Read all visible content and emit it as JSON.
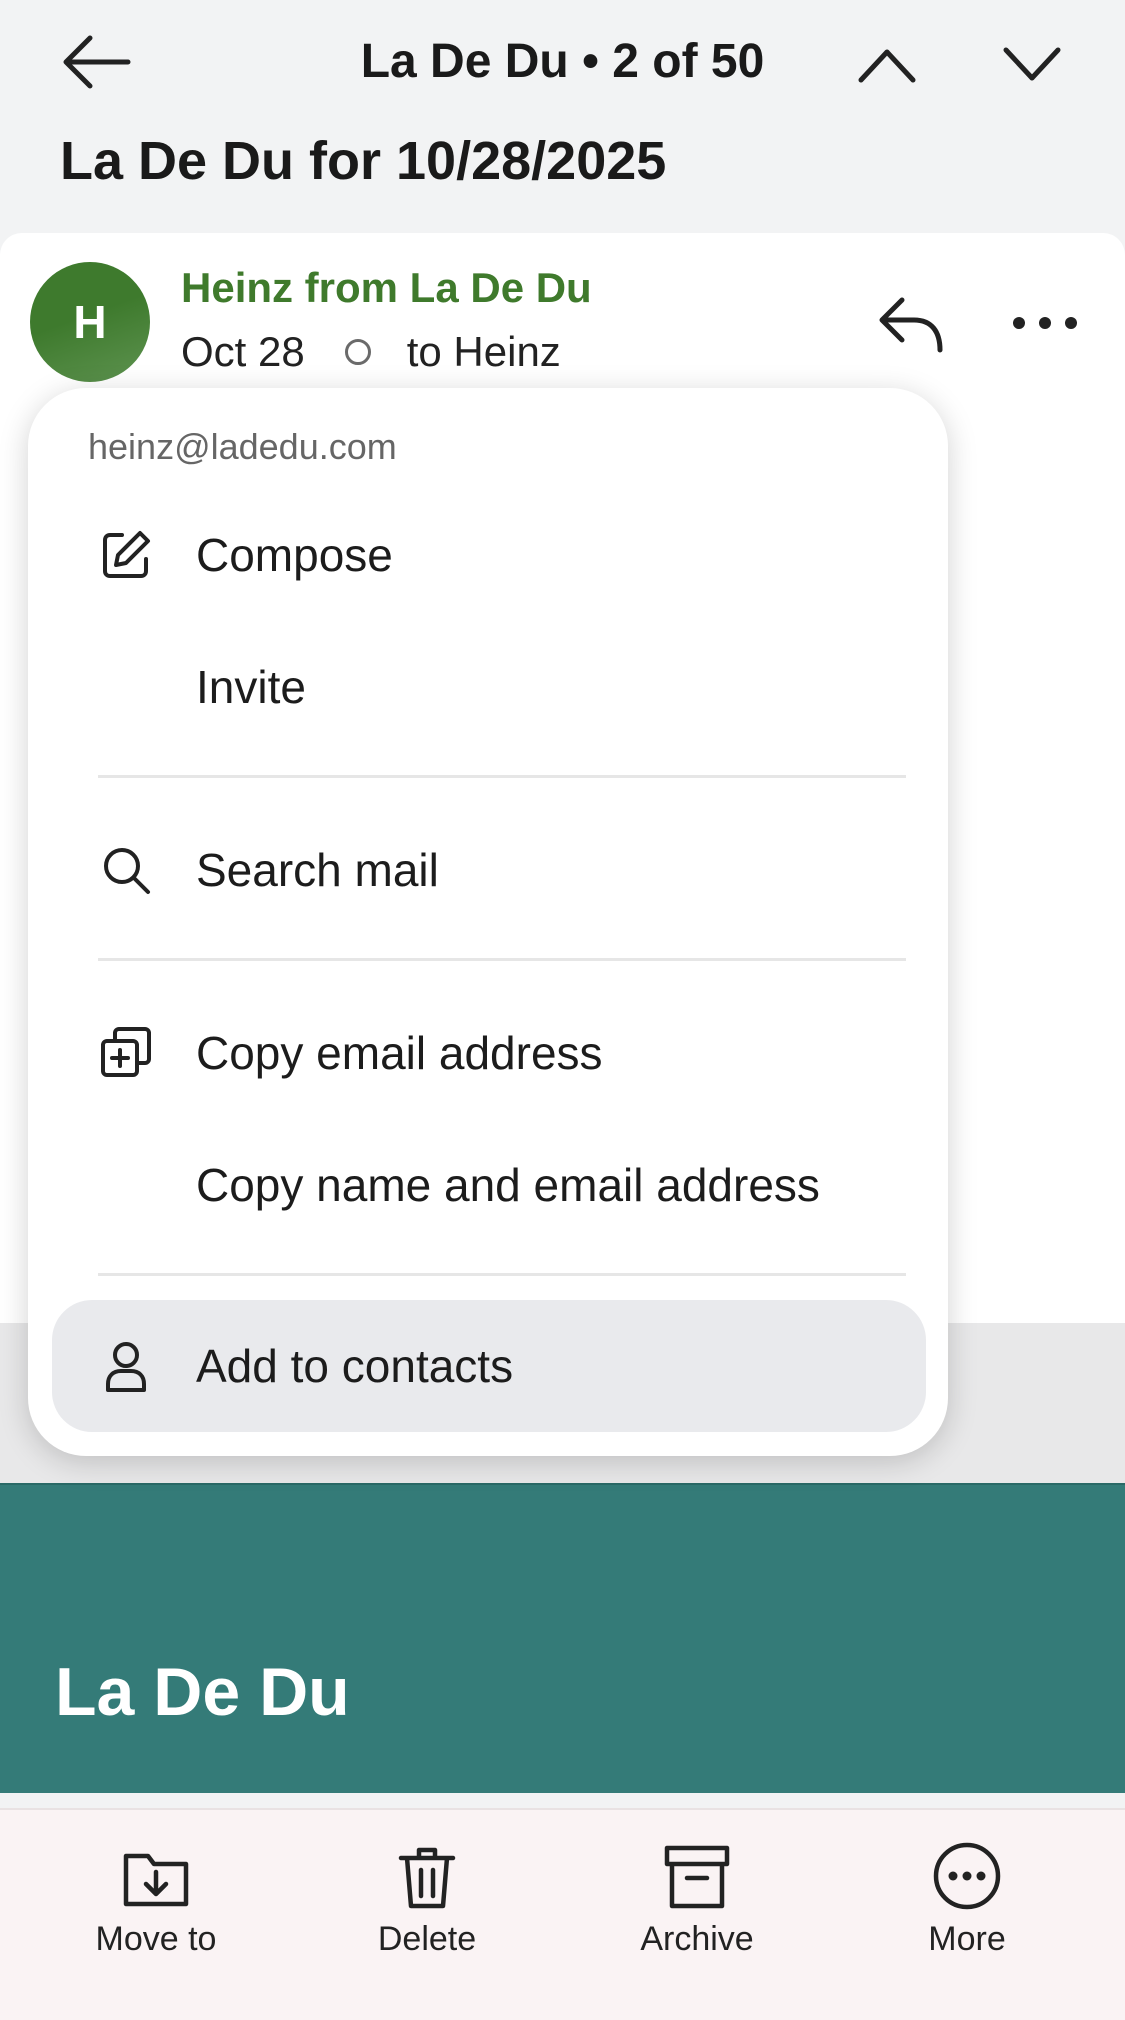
{
  "topbar": {
    "title": "La De Du • 2 of 50"
  },
  "subject": "La De Du for 10/28/2025",
  "message": {
    "avatar_letter": "H",
    "sender": "Heinz from La De Du",
    "date": "Oct 28",
    "recipient": "to Heinz"
  },
  "menu": {
    "email": "heinz@ladedu.com",
    "items": [
      {
        "label": "Compose",
        "icon": "edit-icon"
      },
      {
        "label": "Invite",
        "icon": ""
      },
      {
        "label": "Search mail",
        "icon": "search-icon"
      },
      {
        "label": "Copy email address",
        "icon": "copy-icon"
      },
      {
        "label": "Copy name and email address",
        "icon": ""
      },
      {
        "label": "Add to contacts",
        "icon": "person-icon"
      }
    ]
  },
  "banner": {
    "logo_text": "La De Du"
  },
  "toolbar": {
    "move": "Move to",
    "delete": "Delete",
    "archive": "Archive",
    "more": "More"
  }
}
